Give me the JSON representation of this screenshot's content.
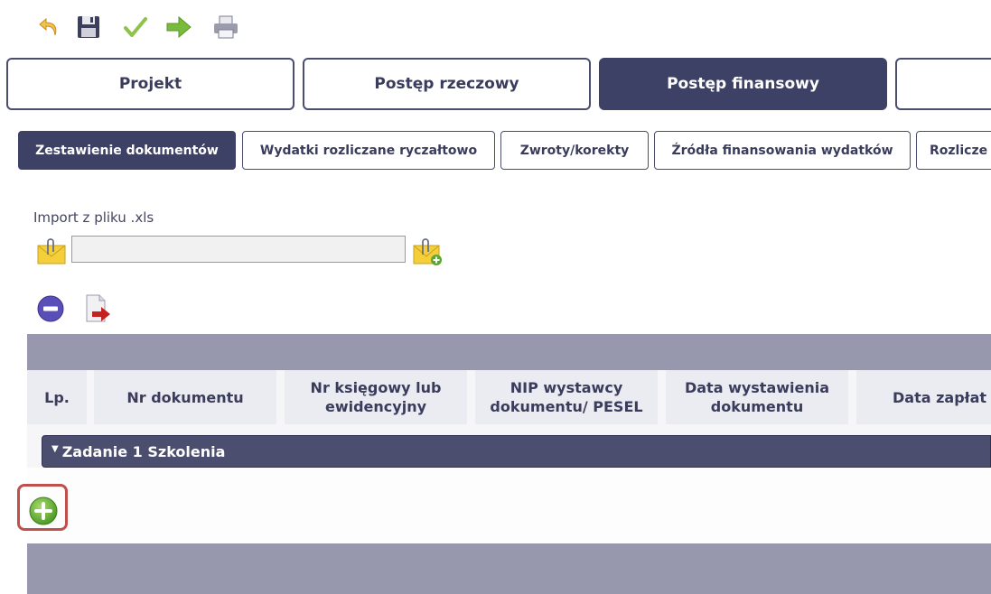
{
  "toolbar": {
    "icons": [
      "undo-icon",
      "save-icon",
      "validate-icon",
      "submit-icon",
      "print-icon"
    ]
  },
  "main_tabs": [
    {
      "label": "Projekt",
      "active": false
    },
    {
      "label": "Postęp rzeczowy",
      "active": false
    },
    {
      "label": "Postęp finansowy",
      "active": true
    },
    {
      "label": "",
      "active": false
    }
  ],
  "sub_tabs": [
    {
      "label": "Zestawienie dokumentów",
      "active": true
    },
    {
      "label": "Wydatki rozliczane ryczałtowo",
      "active": false
    },
    {
      "label": "Zwroty/korekty",
      "active": false
    },
    {
      "label": "Źródła finansowania wydatków",
      "active": false
    },
    {
      "label": "Rozlicze",
      "active": false
    }
  ],
  "import": {
    "label": "Import z pliku .xls",
    "value": "",
    "placeholder": ""
  },
  "table": {
    "columns": [
      "Lp.",
      "Nr dokumentu",
      "Nr księgowy lub\newidencyjny",
      "NIP wystawcy\ndokumentu/ PESEL",
      "Data wystawienia\ndokumentu",
      "Data zapłat"
    ],
    "group": {
      "label": "Zadanie 1 Szkolenia",
      "expanded": true
    }
  },
  "colors": {
    "accent": "#3e4166",
    "header_bar": "#9798ad",
    "highlight": "#c0504d"
  }
}
